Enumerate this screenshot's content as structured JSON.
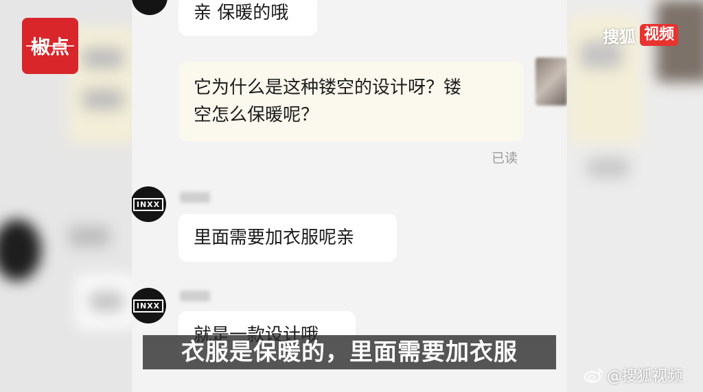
{
  "logo": {
    "text": "椒点"
  },
  "watermark_top": {
    "brand": "搜狐",
    "badge": "视频"
  },
  "chat": {
    "messages": [
      {
        "side": "left",
        "text": "亲 保暖的哦"
      },
      {
        "side": "right",
        "line1": "它为什么是这种镂空的设计呀？镂",
        "line2": "空怎么保暖呢？",
        "status": "已读"
      },
      {
        "side": "left",
        "avatar_text": "INXX",
        "text": "里面需要加衣服呢亲"
      },
      {
        "side": "left",
        "avatar_text": "INXX",
        "text": "就是一款设计哦"
      }
    ]
  },
  "subtitle": {
    "text": "衣服是保暖的，里面需要加衣服"
  },
  "watermark_bottom": {
    "text": "@搜狐视频",
    "icon": "weibo-icon"
  }
}
